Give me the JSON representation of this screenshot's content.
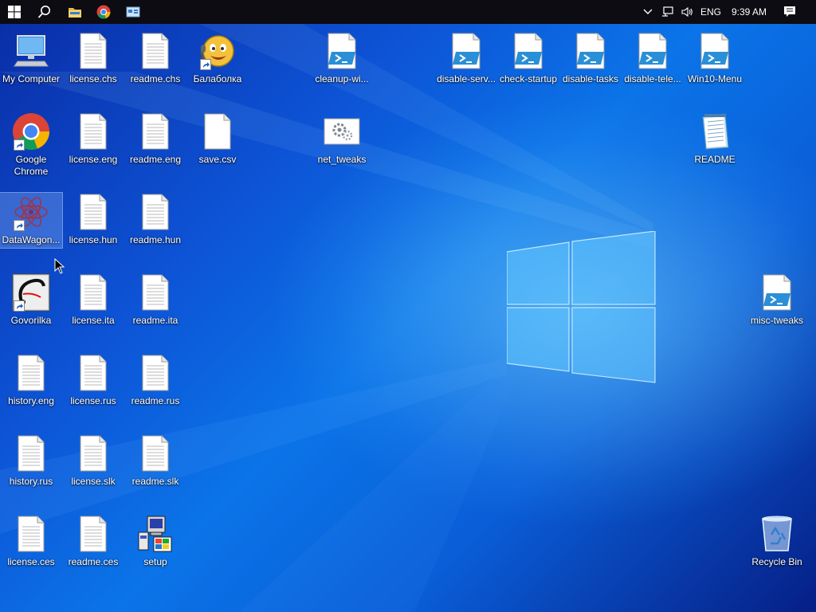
{
  "taskbar": {
    "tray_language": "ENG",
    "tray_time": "9:39 AM"
  },
  "desktop": {
    "icons": [
      {
        "label": "My Computer",
        "type": "computer"
      },
      {
        "label": "license.chs",
        "type": "doc"
      },
      {
        "label": "readme.chs",
        "type": "doc"
      },
      {
        "label": "Балаболка",
        "type": "balabolka"
      },
      {
        "label": "cleanup-wi...",
        "type": "ps"
      },
      {
        "label": "disable-serv...",
        "type": "ps"
      },
      {
        "label": "check-startup",
        "type": "ps"
      },
      {
        "label": "disable-tasks",
        "type": "ps"
      },
      {
        "label": "disable-tele...",
        "type": "ps"
      },
      {
        "label": "Win10-Menu",
        "type": "ps"
      },
      {
        "label": "Google Chrome",
        "type": "chrome"
      },
      {
        "label": "license.eng",
        "type": "doc"
      },
      {
        "label": "readme.eng",
        "type": "doc"
      },
      {
        "label": "save.csv",
        "type": "blank"
      },
      {
        "label": "net_tweaks",
        "type": "gear"
      },
      {
        "label": "README",
        "type": "notepad"
      },
      {
        "label": "DataWagon...",
        "type": "datawagon"
      },
      {
        "label": "license.hun",
        "type": "doc"
      },
      {
        "label": "readme.hun",
        "type": "doc"
      },
      {
        "label": "Govorilka",
        "type": "govorilka"
      },
      {
        "label": "license.ita",
        "type": "doc"
      },
      {
        "label": "readme.ita",
        "type": "doc"
      },
      {
        "label": "misc-tweaks",
        "type": "ps"
      },
      {
        "label": "history.eng",
        "type": "doc"
      },
      {
        "label": "license.rus",
        "type": "doc"
      },
      {
        "label": "readme.rus",
        "type": "doc"
      },
      {
        "label": "history.rus",
        "type": "doc"
      },
      {
        "label": "license.slk",
        "type": "doc"
      },
      {
        "label": "readme.slk",
        "type": "doc"
      },
      {
        "label": "license.ces",
        "type": "doc"
      },
      {
        "label": "readme.ces",
        "type": "doc"
      },
      {
        "label": "setup",
        "type": "setup"
      },
      {
        "label": "Recycle Bin",
        "type": "recycle"
      }
    ]
  }
}
